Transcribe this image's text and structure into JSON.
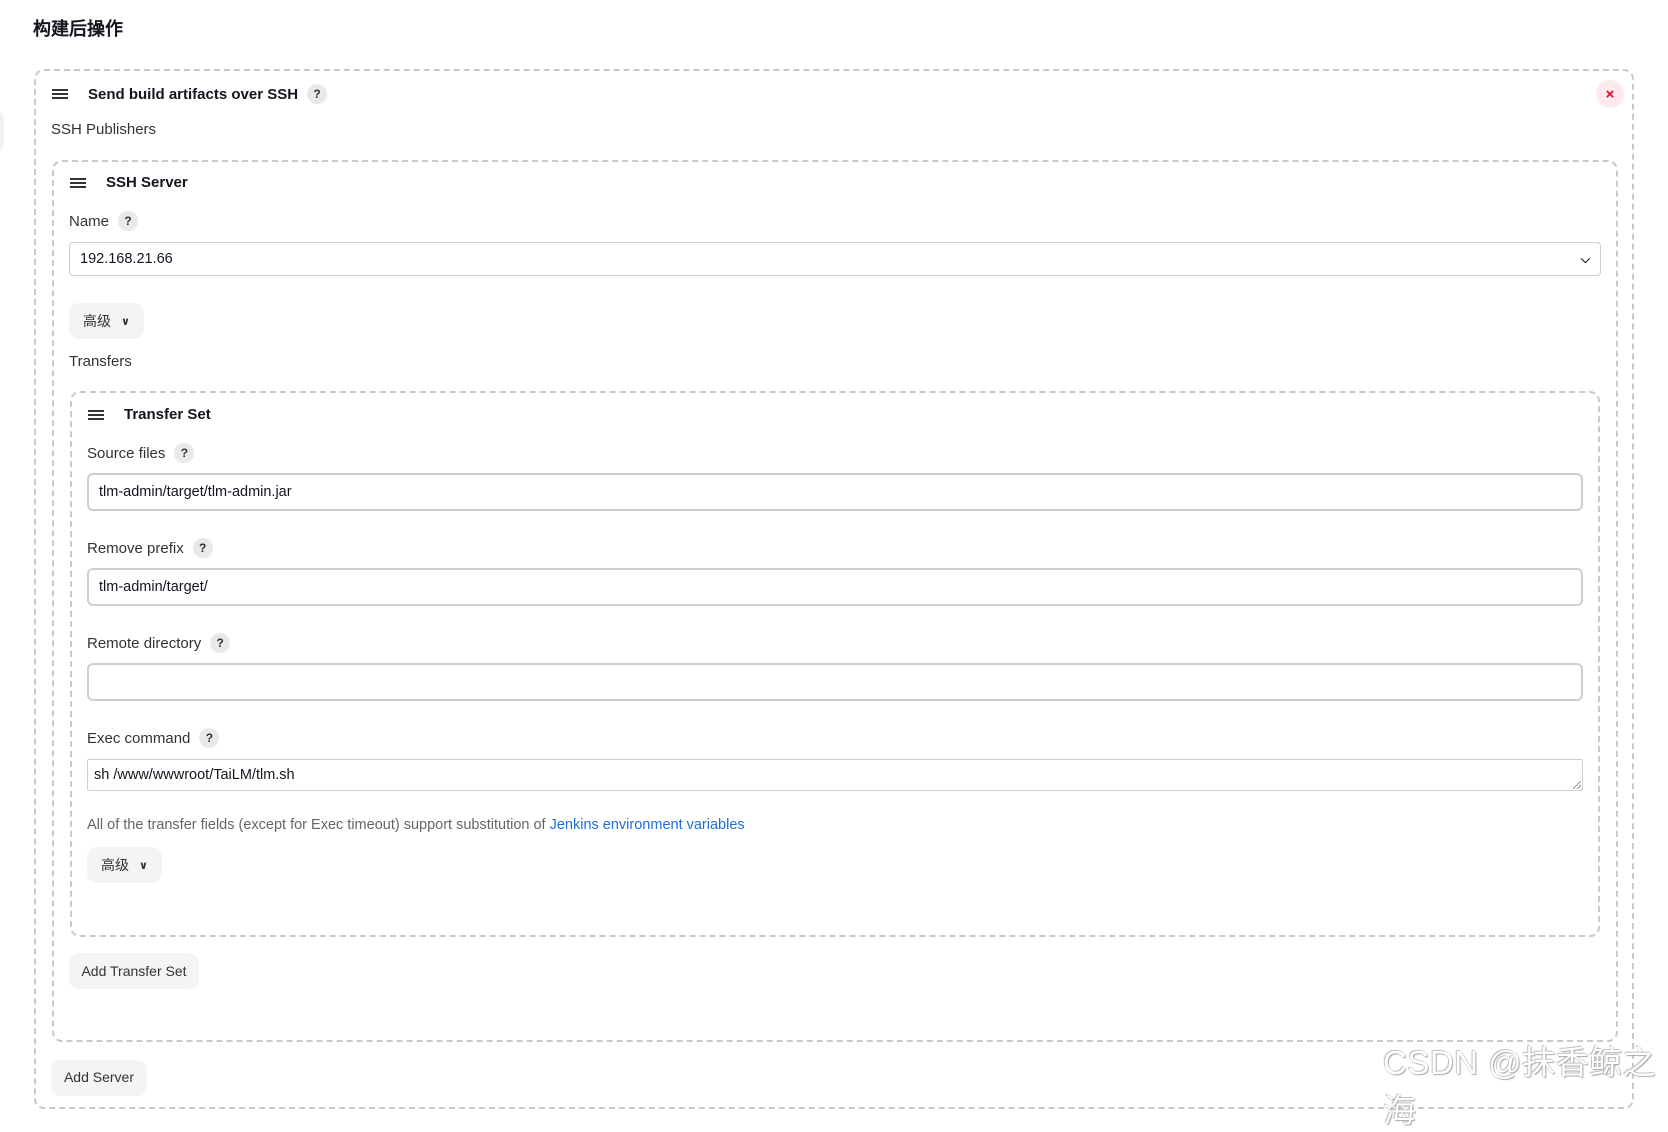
{
  "section_title": "构建后操作",
  "publisher": {
    "title": "Send build artifacts over SSH",
    "help": "?",
    "close_icon": "×",
    "ssh_publishers_label": "SSH Publishers",
    "server": {
      "title": "SSH Server",
      "name_label": "Name",
      "help": "?",
      "name_value": "192.168.21.66",
      "advanced_label": "高级",
      "advanced_icon": "⌄",
      "transfers_label": "Transfers",
      "transfer_set": {
        "title": "Transfer Set",
        "source_files_label": "Source files",
        "source_files_value": "tlm-admin/target/tlm-admin.jar",
        "remove_prefix_label": "Remove prefix",
        "remove_prefix_value": "tlm-admin/target/",
        "remote_directory_label": "Remote directory",
        "remote_directory_value": "",
        "exec_command_label": "Exec command",
        "exec_command_value": "sh /www/wwwroot/TaiLM/tlm.sh",
        "help": "?",
        "hint_text": "All of the transfer fields (except for Exec timeout) support substitution of ",
        "hint_link": "Jenkins environment variables",
        "advanced_label": "高级"
      },
      "add_transfer_set_label": "Add Transfer Set"
    },
    "add_server_label": "Add Server"
  },
  "watermark": "CSDN @抹香鲸之海"
}
